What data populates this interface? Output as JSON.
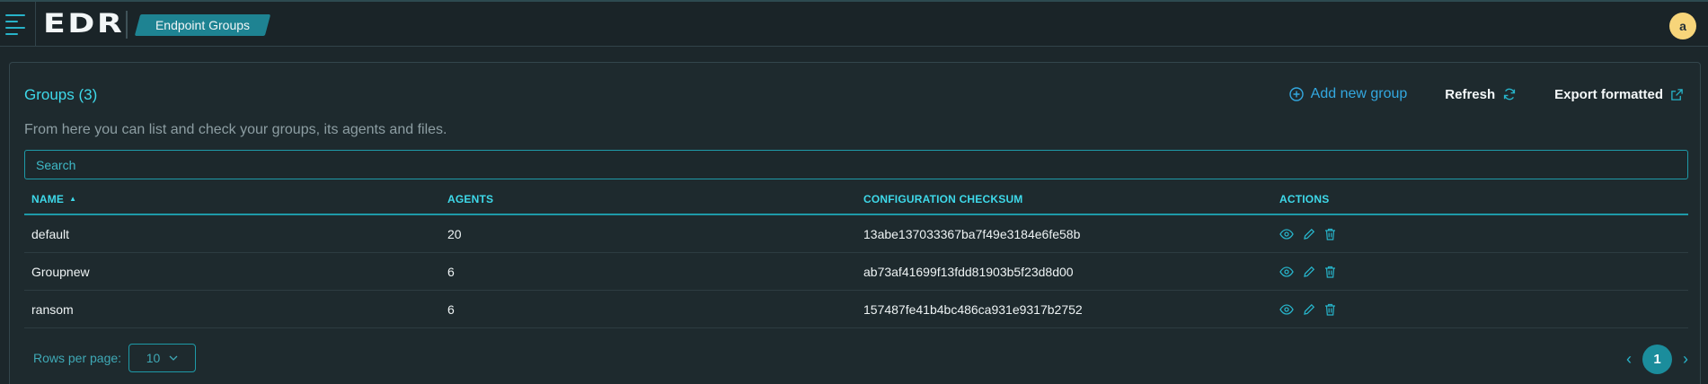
{
  "app": {
    "logo_text": "EDR",
    "avatar_initial": "a"
  },
  "breadcrumb": {
    "current": "Endpoint Groups"
  },
  "groups": {
    "title": "Groups (3)",
    "description": "From here you can list and check your groups, its agents and files.",
    "actions": {
      "add_label": "Add new group",
      "refresh_label": "Refresh",
      "export_label": "Export formatted"
    },
    "search": {
      "placeholder": "Search",
      "value": ""
    },
    "columns": [
      "NAME",
      "AGENTS",
      "CONFIGURATION CHECKSUM",
      "ACTIONS"
    ],
    "rows": [
      {
        "name": "default",
        "agents": "20",
        "checksum": "13abe137033367ba7f49e3184e6fe58b"
      },
      {
        "name": "Groupnew",
        "agents": "6",
        "checksum": "ab73af41699f13fdd81903b5f23d8d00"
      },
      {
        "name": "ransom",
        "agents": "6",
        "checksum": "157487fe41b4bc486ca931e9317b2752"
      }
    ],
    "footer": {
      "rows_per_page_label": "Rows per page:",
      "rows_per_page_value": "10",
      "current_page": "1"
    }
  },
  "icons": {
    "menu": "hamburger-icon",
    "add": "plus-circle-icon",
    "refresh": "refresh-icon",
    "export": "external-link-icon",
    "view": "eye-icon",
    "edit": "pencil-icon",
    "delete": "trash-icon"
  },
  "colors": {
    "accent": "#3ed9ea",
    "brand_teal": "#1e8392",
    "link_blue": "#33a8e0",
    "avatar": "#f7d57a"
  }
}
